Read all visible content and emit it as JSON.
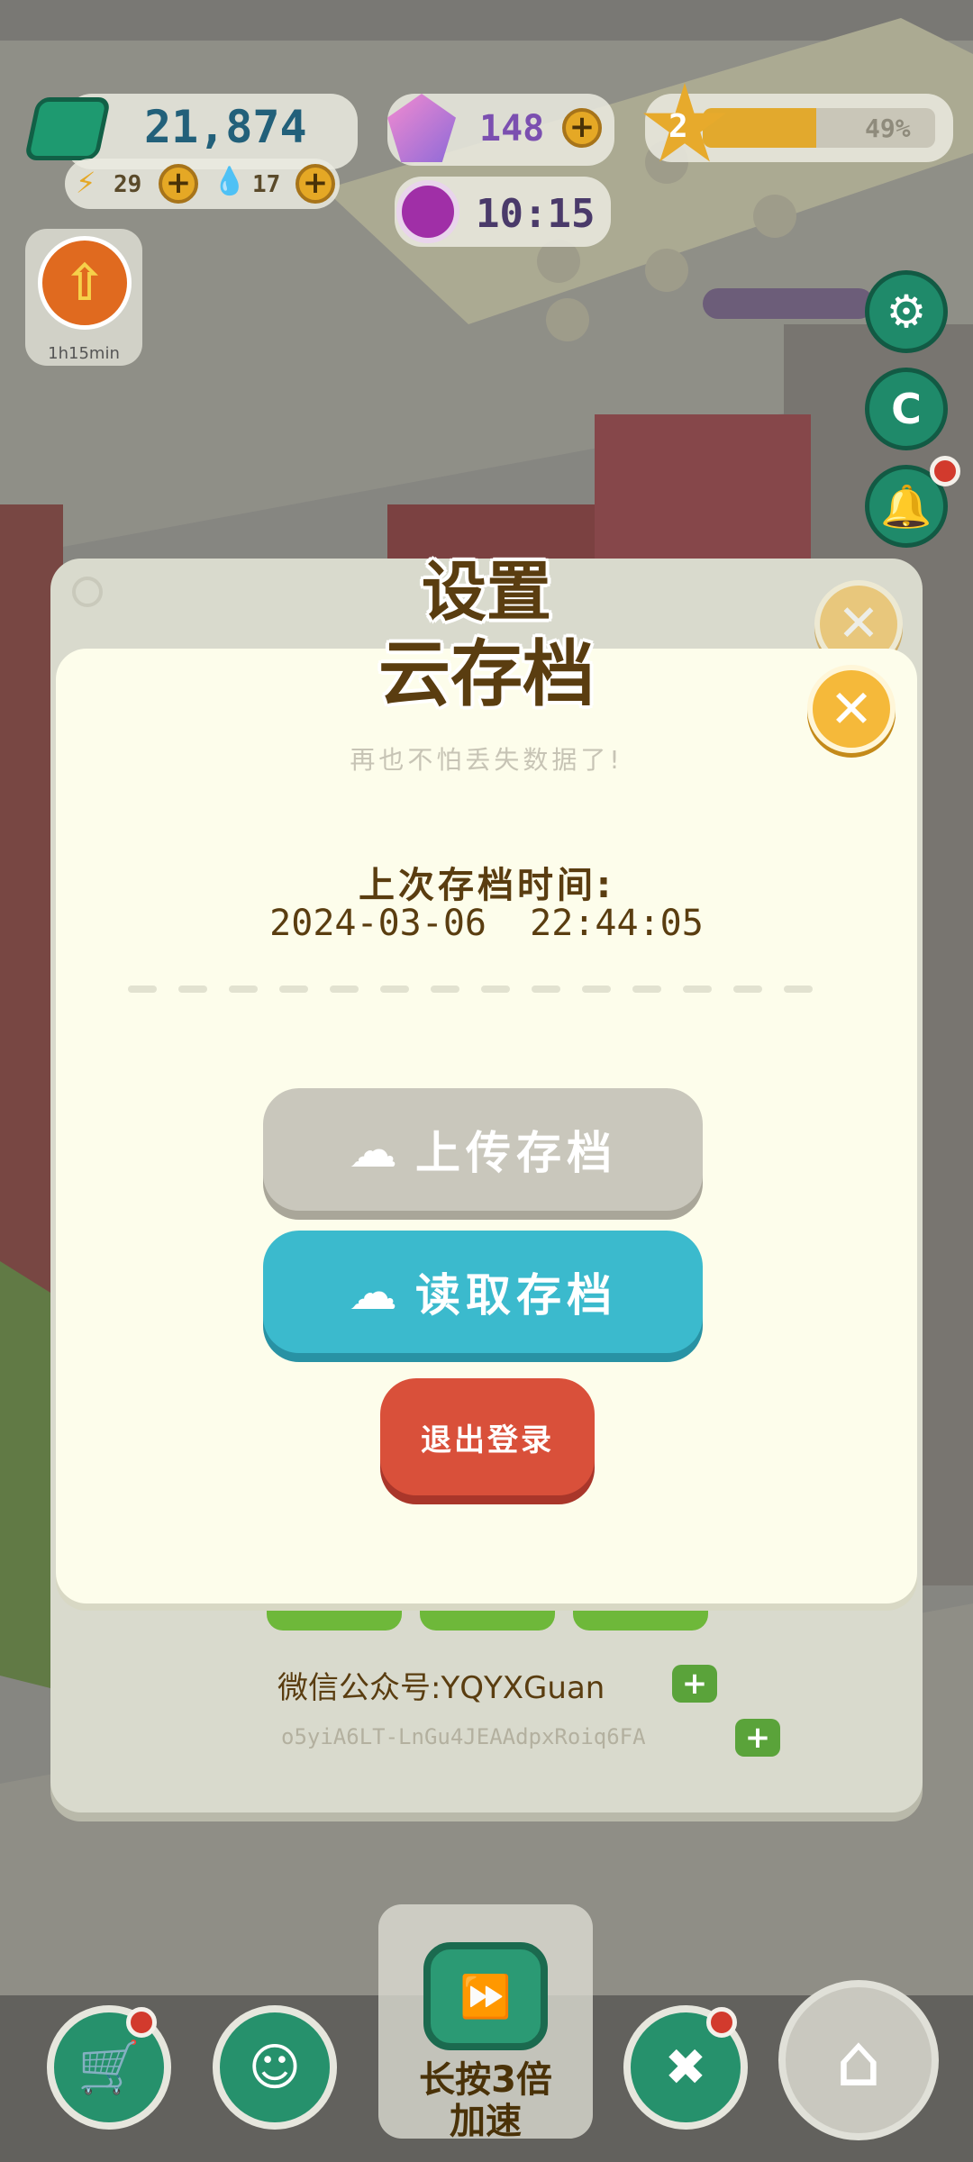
{
  "hud": {
    "money": "21,874",
    "energy": "29",
    "water": "17",
    "gems": "148",
    "clock": "10:15",
    "level": "2",
    "level_progress_label": "49%",
    "level_progress": 0.49,
    "boost_timer": "1h15min"
  },
  "settings_panel": {
    "title": "设置",
    "wechat_label": "微信公众号:YQYXGuan",
    "user_id": "o5yiA6LT-LnGu4JEAAdpxRoiq6FA"
  },
  "cloud_save_dialog": {
    "title": "云存档",
    "subtitle": "再也不怕丢失数据了!",
    "last_save_label": "上次存档时间:",
    "last_save_time": "2024-03-06  22:44:05",
    "upload_button": "上传存档",
    "download_button": "读取存档",
    "logout_button": "退出登录"
  },
  "bottom_bar": {
    "speed_label_line1": "长按3倍",
    "speed_label_line2": "加速"
  },
  "colors": {
    "upload_button": "#c9c7bc",
    "download_button": "#3bbacd",
    "logout_button": "#d9503a",
    "panel": "#fdfdeb",
    "title": "#5a3d10"
  }
}
